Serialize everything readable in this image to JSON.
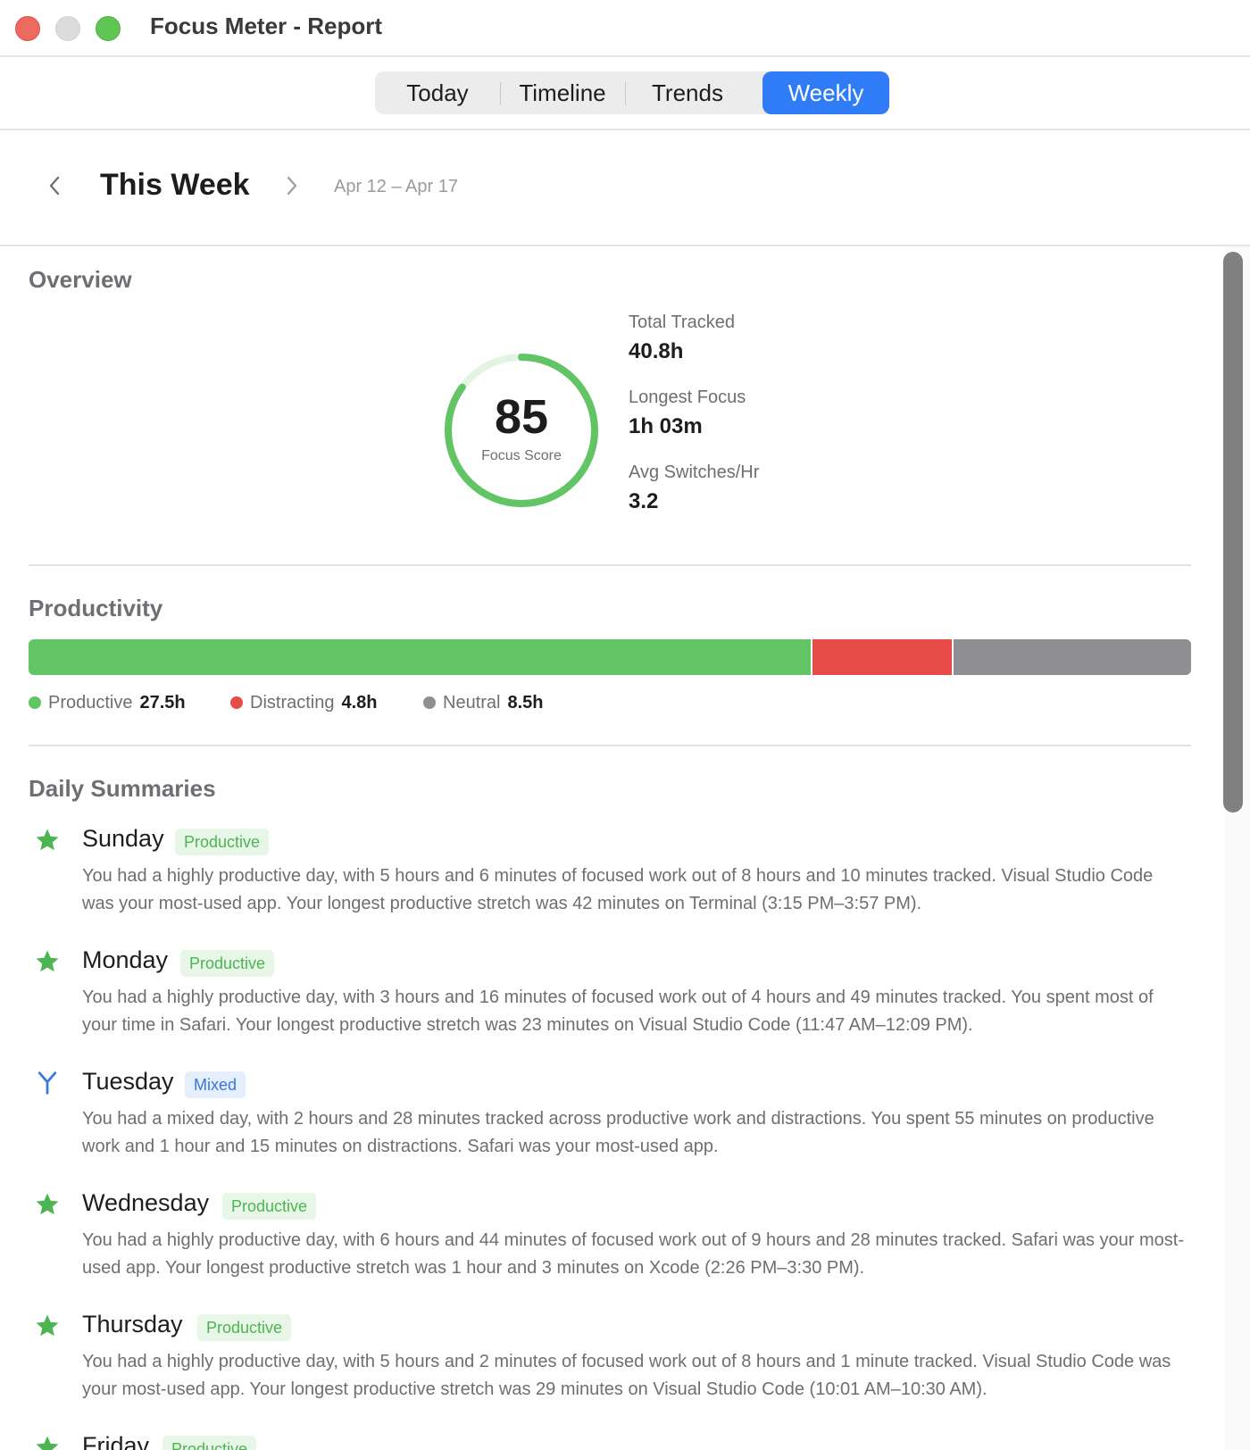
{
  "window": {
    "title": "Focus Meter - Report"
  },
  "tabs": [
    {
      "label": "Today"
    },
    {
      "label": "Timeline"
    },
    {
      "label": "Trends"
    },
    {
      "label": "Weekly",
      "active": true
    }
  ],
  "week": {
    "title": "This Week",
    "range": "Apr 12 – Apr 17",
    "prev_icon": "chevron-left-icon",
    "next_icon": "chevron-right-icon"
  },
  "overview": {
    "title": "Overview",
    "focus_score": {
      "value": "85",
      "label": "Focus Score",
      "fraction": 0.85
    },
    "stats": [
      {
        "label": "Total Tracked",
        "value": "40.8h"
      },
      {
        "label": "Longest Focus",
        "value": "1h 03m"
      },
      {
        "label": "Avg Switches/Hr",
        "value": "3.2"
      }
    ]
  },
  "productivity": {
    "title": "Productivity",
    "categories": [
      {
        "label": "Productive",
        "value": "27.5h",
        "hours": 27.5,
        "color": "#62c464"
      },
      {
        "label": "Distracting",
        "value": "4.8h",
        "hours": 4.8,
        "color": "#e84c48"
      },
      {
        "label": "Neutral",
        "value": "8.5h",
        "hours": 8.5,
        "color": "#8e8e93"
      }
    ]
  },
  "daily": {
    "title": "Daily Summaries",
    "days": [
      {
        "name": "Sunday",
        "badge": "Productive",
        "icon": "star-icon",
        "text": "You had a highly productive day, with 5 hours and 6 minutes of focused work out of 8 hours and 10 minutes tracked. Visual Studio Code was your most-used app. Your longest productive stretch was 42 minutes on Terminal (3:15 PM–3:57 PM)."
      },
      {
        "name": "Monday",
        "badge": "Productive",
        "icon": "star-icon",
        "text": "You had a highly productive day, with 3 hours and 16 minutes of focused work out of 4 hours and 49 minutes tracked. You spent most of your time in Safari. Your longest productive stretch was 23 minutes on Visual Studio Code (11:47 AM–12:09 PM)."
      },
      {
        "name": "Tuesday",
        "badge": "Mixed",
        "icon": "fork-icon",
        "text": "You had a mixed day, with 2 hours and 28 minutes tracked across productive work and distractions. You spent 55 minutes on productive work and 1 hour and 15 minutes on distractions. Safari was your most-used app."
      },
      {
        "name": "Wednesday",
        "badge": "Productive",
        "icon": "star-icon",
        "text": "You had a highly productive day, with 6 hours and 44 minutes of focused work out of 9 hours and 28 minutes tracked. Safari was your most-used app. Your longest productive stretch was 1 hour and 3 minutes on Xcode (2:26 PM–3:30 PM)."
      },
      {
        "name": "Thursday",
        "badge": "Productive",
        "icon": "star-icon",
        "text": "You had a highly productive day, with 5 hours and 2 minutes of focused work out of 8 hours and 1 minute tracked. Visual Studio Code was your most-used app. Your longest productive stretch was 29 minutes on Visual Studio Code (10:01 AM–10:30 AM)."
      },
      {
        "name": "Friday",
        "badge": "Productive",
        "icon": "star-icon",
        "text": ""
      }
    ]
  },
  "colors": {
    "accent": "#2f7cf6",
    "productive": "#62c464",
    "distracting": "#e84c48",
    "neutral": "#8e8e93"
  }
}
